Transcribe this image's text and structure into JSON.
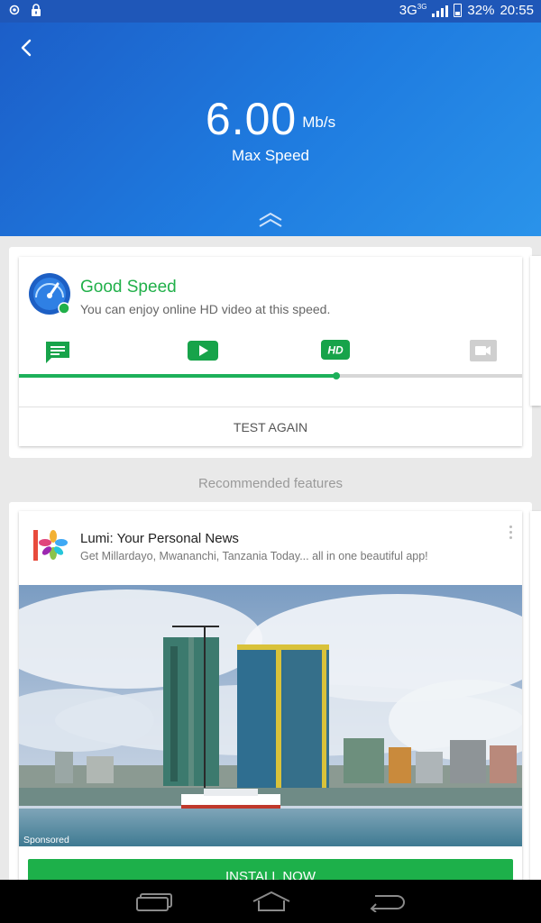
{
  "status_bar": {
    "network": "3G",
    "network_sup": "3G",
    "battery": "32%",
    "time": "20:55",
    "icons": [
      "target-icon",
      "lock-icon",
      "signal-icon",
      "battery-icon"
    ]
  },
  "header": {
    "speed_value": "6.00",
    "speed_unit": "Mb/s",
    "speed_label": "Max Speed",
    "back_icon": "back-arrow-icon",
    "expand_icon": "double-chevron-up-icon"
  },
  "result": {
    "title": "Good Speed",
    "subtitle": "You can enjoy online HD video at this speed.",
    "level_icons": [
      "message-icon",
      "video-play-icon",
      "hd-icon",
      "camera-icon"
    ],
    "hd_label": "HD",
    "progress_fraction": 0.63,
    "test_again_label": "TEST AGAIN"
  },
  "recommended": {
    "heading": "Recommended features"
  },
  "ad": {
    "title": "Lumi: Your Personal News",
    "description": "Get Millardayo, Mwananchi, Tanzania Today... all in one beautiful app!",
    "sponsored_label": "Sponsored",
    "install_label": "INSTALL NOW"
  },
  "colors": {
    "header_blue": "#1f72d9",
    "accent_green": "#1db04a",
    "status_bar": "#1f57b8"
  }
}
